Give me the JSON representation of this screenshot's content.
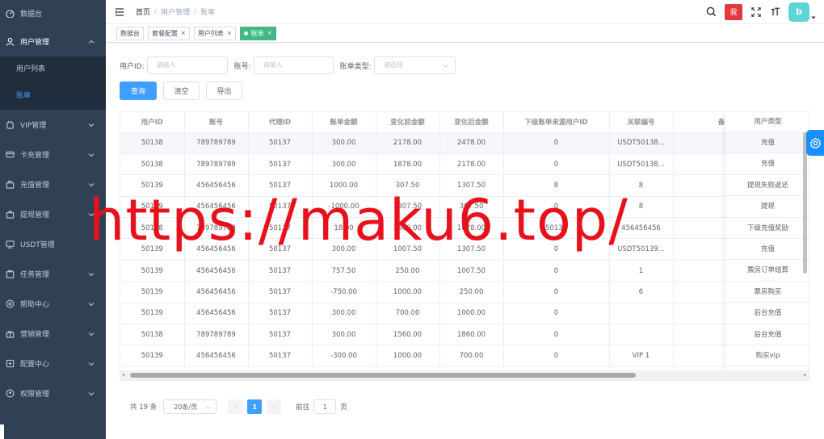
{
  "sidebar": {
    "items": [
      {
        "label": "数据台",
        "icon": "dashboard-icon"
      },
      {
        "label": "用户管理",
        "icon": "user-icon",
        "open": true
      },
      {
        "label": "VIP管理",
        "icon": "vip-icon"
      },
      {
        "label": "卡充管理",
        "icon": "card-icon"
      },
      {
        "label": "充值管理",
        "icon": "recharge-icon"
      },
      {
        "label": "提现管理",
        "icon": "withdraw-icon"
      },
      {
        "label": "USDT管理",
        "icon": "usdt-icon"
      },
      {
        "label": "任务管理",
        "icon": "task-icon"
      },
      {
        "label": "帮助中心",
        "icon": "help-icon"
      },
      {
        "label": "营销管理",
        "icon": "marketing-icon"
      },
      {
        "label": "配置中心",
        "icon": "config-icon"
      },
      {
        "label": "权限管理",
        "icon": "permission-icon"
      }
    ],
    "sub_items": [
      {
        "label": "用户列表"
      },
      {
        "label": "账单",
        "active": true
      }
    ]
  },
  "navbar": {
    "breadcrumb": [
      "首页",
      "用户管理",
      "账单"
    ],
    "badge": "我",
    "avatar_text": "b"
  },
  "tags": [
    {
      "label": "数据台"
    },
    {
      "label": "套餐配置"
    },
    {
      "label": "用户列表"
    },
    {
      "label": "账单",
      "active": true
    }
  ],
  "filters": {
    "user_id_label": "用户ID:",
    "user_id_placeholder": "请输入",
    "account_label": "账号:",
    "account_placeholder": "请输入",
    "bill_type_label": "账单类型:",
    "bill_type_placeholder": "请选择"
  },
  "buttons": {
    "query": "查询",
    "clear": "清空",
    "export": "导出"
  },
  "table": {
    "columns": [
      "用户ID",
      "账号",
      "代理ID",
      "账单金额",
      "变化前金额",
      "变化后金额",
      "下级账单来源用户ID",
      "关联编号",
      "备"
    ],
    "fixed_column": "用户类型",
    "rows": [
      [
        "50138",
        "789789789",
        "50137",
        "300.00",
        "2178.00",
        "2478.00",
        "0",
        "USDT50138...",
        ""
      ],
      [
        "50138",
        "789789789",
        "50137",
        "300.00",
        "1878.00",
        "2178.00",
        "0",
        "USDT50138...",
        ""
      ],
      [
        "50139",
        "456456456",
        "50137",
        "1000.00",
        "307.50",
        "1307.50",
        "8",
        "8",
        ""
      ],
      [
        "50139",
        "456456456",
        "50137",
        "-1000.00",
        "1307.50",
        "307.50",
        "0",
        "8",
        ""
      ],
      [
        "50138",
        "789789789",
        "50137",
        "18.00",
        "1860.00",
        "1878.00",
        "50139",
        "456456456",
        ""
      ],
      [
        "50139",
        "456456456",
        "50137",
        "300.00",
        "1007.50",
        "1307.50",
        "0",
        "USDT50139...",
        ""
      ],
      [
        "50139",
        "456456456",
        "50137",
        "757.50",
        "250.00",
        "1007.50",
        "0",
        "1",
        ""
      ],
      [
        "50139",
        "456456456",
        "50137",
        "-750.00",
        "1000.00",
        "250.00",
        "0",
        "6",
        ""
      ],
      [
        "50139",
        "456456456",
        "50137",
        "300.00",
        "700.00",
        "1000.00",
        "0",
        "",
        ""
      ],
      [
        "50138",
        "789789789",
        "50137",
        "300.00",
        "1560.00",
        "1860.00",
        "0",
        "",
        ""
      ],
      [
        "50139",
        "456456456",
        "50137",
        "-300.00",
        "1000.00",
        "700.00",
        "0",
        "VIP 1",
        ""
      ]
    ],
    "fixed_values": [
      "充值",
      "充值",
      "提现失败返还",
      "提现",
      "下级充值奖励",
      "充值",
      "票房订单结算",
      "票房购买",
      "后台充值",
      "后台充值",
      "购买vip"
    ]
  },
  "pagination": {
    "total": "共 19 条",
    "page_size": "20条/页",
    "prev": "‹",
    "current": "1",
    "next": "›",
    "goto_label": "前往",
    "goto_value": "1",
    "goto_suffix": "页"
  },
  "watermark": "https://maku6.top/"
}
